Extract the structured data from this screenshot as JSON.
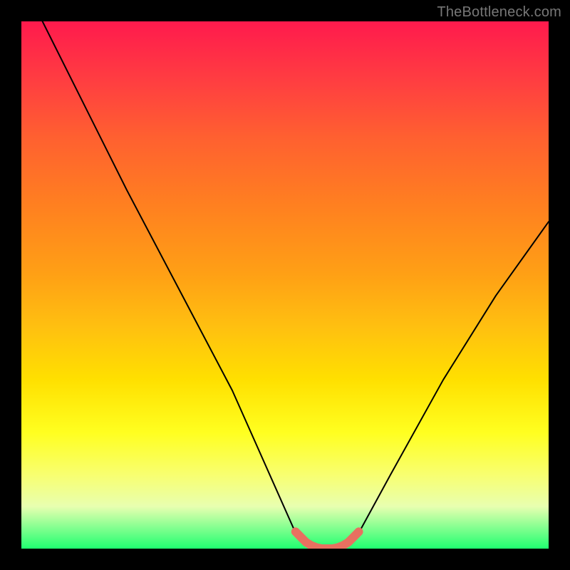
{
  "watermark": "TheBottleneck.com",
  "gradient_colors": {
    "top": "#ff1a4d",
    "mid1": "#ff8020",
    "mid2": "#ffe000",
    "bottom": "#20ff70"
  },
  "chart_data": {
    "type": "line",
    "title": "",
    "xlabel": "",
    "ylabel": "",
    "xlim": [
      0,
      100
    ],
    "ylim": [
      0,
      100
    ],
    "grid": false,
    "series": [
      {
        "name": "bottleneck-curve",
        "x": [
          4,
          10,
          20,
          30,
          40,
          48,
          52,
          55,
          58,
          61,
          64,
          70,
          80,
          90,
          100
        ],
        "y": [
          100,
          88,
          68,
          49,
          30,
          12,
          3,
          0.5,
          0,
          0.5,
          3,
          14,
          32,
          48,
          62
        ]
      },
      {
        "name": "optimal-band",
        "x": [
          52,
          53,
          54,
          55,
          56,
          57,
          58,
          59,
          60,
          61,
          62,
          63,
          64
        ],
        "y": [
          3.2,
          2.2,
          1.2,
          0.6,
          0.2,
          0.0,
          0.0,
          0.0,
          0.2,
          0.6,
          1.2,
          2.2,
          3.2
        ]
      }
    ],
    "annotations": []
  }
}
